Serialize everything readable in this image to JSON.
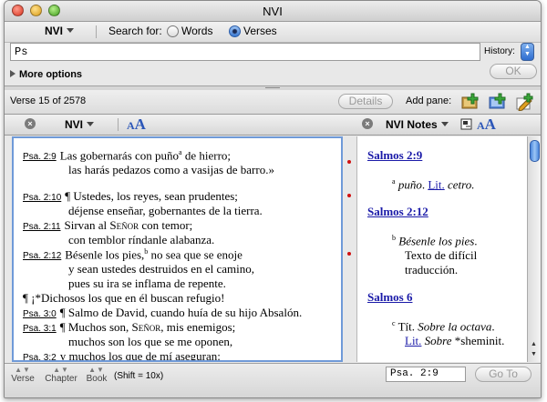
{
  "window": {
    "title": "NVI"
  },
  "search": {
    "module": "NVI",
    "search_for_label": "Search for:",
    "options": [
      {
        "label": "Words",
        "selected": false
      },
      {
        "label": "Verses",
        "selected": true
      }
    ],
    "query": "Ps",
    "history_label": "History:",
    "ok_label": "OK",
    "more_options_label": "More options"
  },
  "status": {
    "verse_count": "Verse 15  of 2578",
    "details_label": "Details",
    "add_pane_label": "Add pane:"
  },
  "left_pane": {
    "module": "NVI",
    "font_icon": {
      "small": "A",
      "big": "A"
    }
  },
  "right_pane": {
    "module": "NVI Notes",
    "font_icon": {
      "small": "A",
      "big": "A"
    }
  },
  "verses": [
    {
      "ref": "Psa. 2:9",
      "pre": "Las gobernarás con puño",
      "sup": "a",
      "post": " de hierro;"
    },
    {
      "ref": "",
      "pre": "las harás pedazos como a vasijas de barro.»",
      "sup": "",
      "post": ""
    },
    {
      "ref": "Psa. 2:10",
      "pre": "¶ Ustedes, los reyes, sean prudentes;",
      "sup": "",
      "post": ""
    },
    {
      "ref": "",
      "pre": "déjense enseñar, gobernantes de la tierra.",
      "sup": "",
      "post": ""
    },
    {
      "ref": "Psa. 2:11",
      "pre": "Sirvan al ",
      "sc": "Señor",
      "post": " con temor;"
    },
    {
      "ref": "",
      "pre": "con temblor ríndanle alabanza.",
      "sup": "",
      "post": ""
    },
    {
      "ref": "Psa. 2:12",
      "pre": "Bésenle los pies,",
      "sup": "b",
      "post": " no sea que se enoje"
    },
    {
      "ref": "",
      "pre": "y sean ustedes destruidos en el camino,",
      "sup": "",
      "post": ""
    },
    {
      "ref": "",
      "pre": "pues su ira se inflama de repente.",
      "sup": "",
      "post": ""
    },
    {
      "ref": "",
      "pre": "¶    ¡*Dichosos los que en él buscan refugio!",
      "sup": "",
      "post": ""
    },
    {
      "ref": "Psa. 3:0",
      "pre": "¶ Salmo de David, cuando huía de su hijo Absalón.",
      "sup": "",
      "post": ""
    },
    {
      "ref": "Psa. 3:1",
      "pre": "¶ Muchos son, ",
      "sc": "Señor",
      "post": ", mis enemigos;"
    },
    {
      "ref": "",
      "pre": "muchos son los que se me oponen,",
      "sup": "",
      "post": ""
    },
    {
      "ref": "Psa. 3:2",
      "pre": "y muchos los que de mí aseguran:",
      "sup": "",
      "post": ""
    }
  ],
  "notes": [
    {
      "heading": "Salmos 2:9",
      "lines": [
        {
          "mark": "a",
          "italic": "puño",
          "after": ". ",
          "link": "Lit.",
          "tail": " cetro."
        }
      ]
    },
    {
      "heading": "Salmos 2:12",
      "lines": [
        {
          "mark": "b",
          "italic": "Bésenle los pies",
          "after": "."
        },
        {
          "plain": "Texto de difícil"
        },
        {
          "plain": "traducción."
        }
      ]
    },
    {
      "heading": "Salmos 6",
      "lines": [
        {
          "mark": "c",
          "plain": "Tít. ",
          "italic": "Sobre la octava",
          "after": "."
        },
        {
          "link": "Lit.",
          "italic": " Sobre ",
          "plain": "*sheminit",
          "after": "."
        }
      ]
    }
  ],
  "bottom": {
    "nav": [
      {
        "label": "Verse"
      },
      {
        "label": "Chapter"
      },
      {
        "label": "Book"
      }
    ],
    "shift_hint": "(Shift = 10x)",
    "goto_value": "Psa. 2:9",
    "goto_label": "Go To"
  },
  "colors": {
    "accent": "#2b56b8",
    "link": "#1a1aa8",
    "marker": "#d01010",
    "focus_border": "#6f9ad8"
  }
}
